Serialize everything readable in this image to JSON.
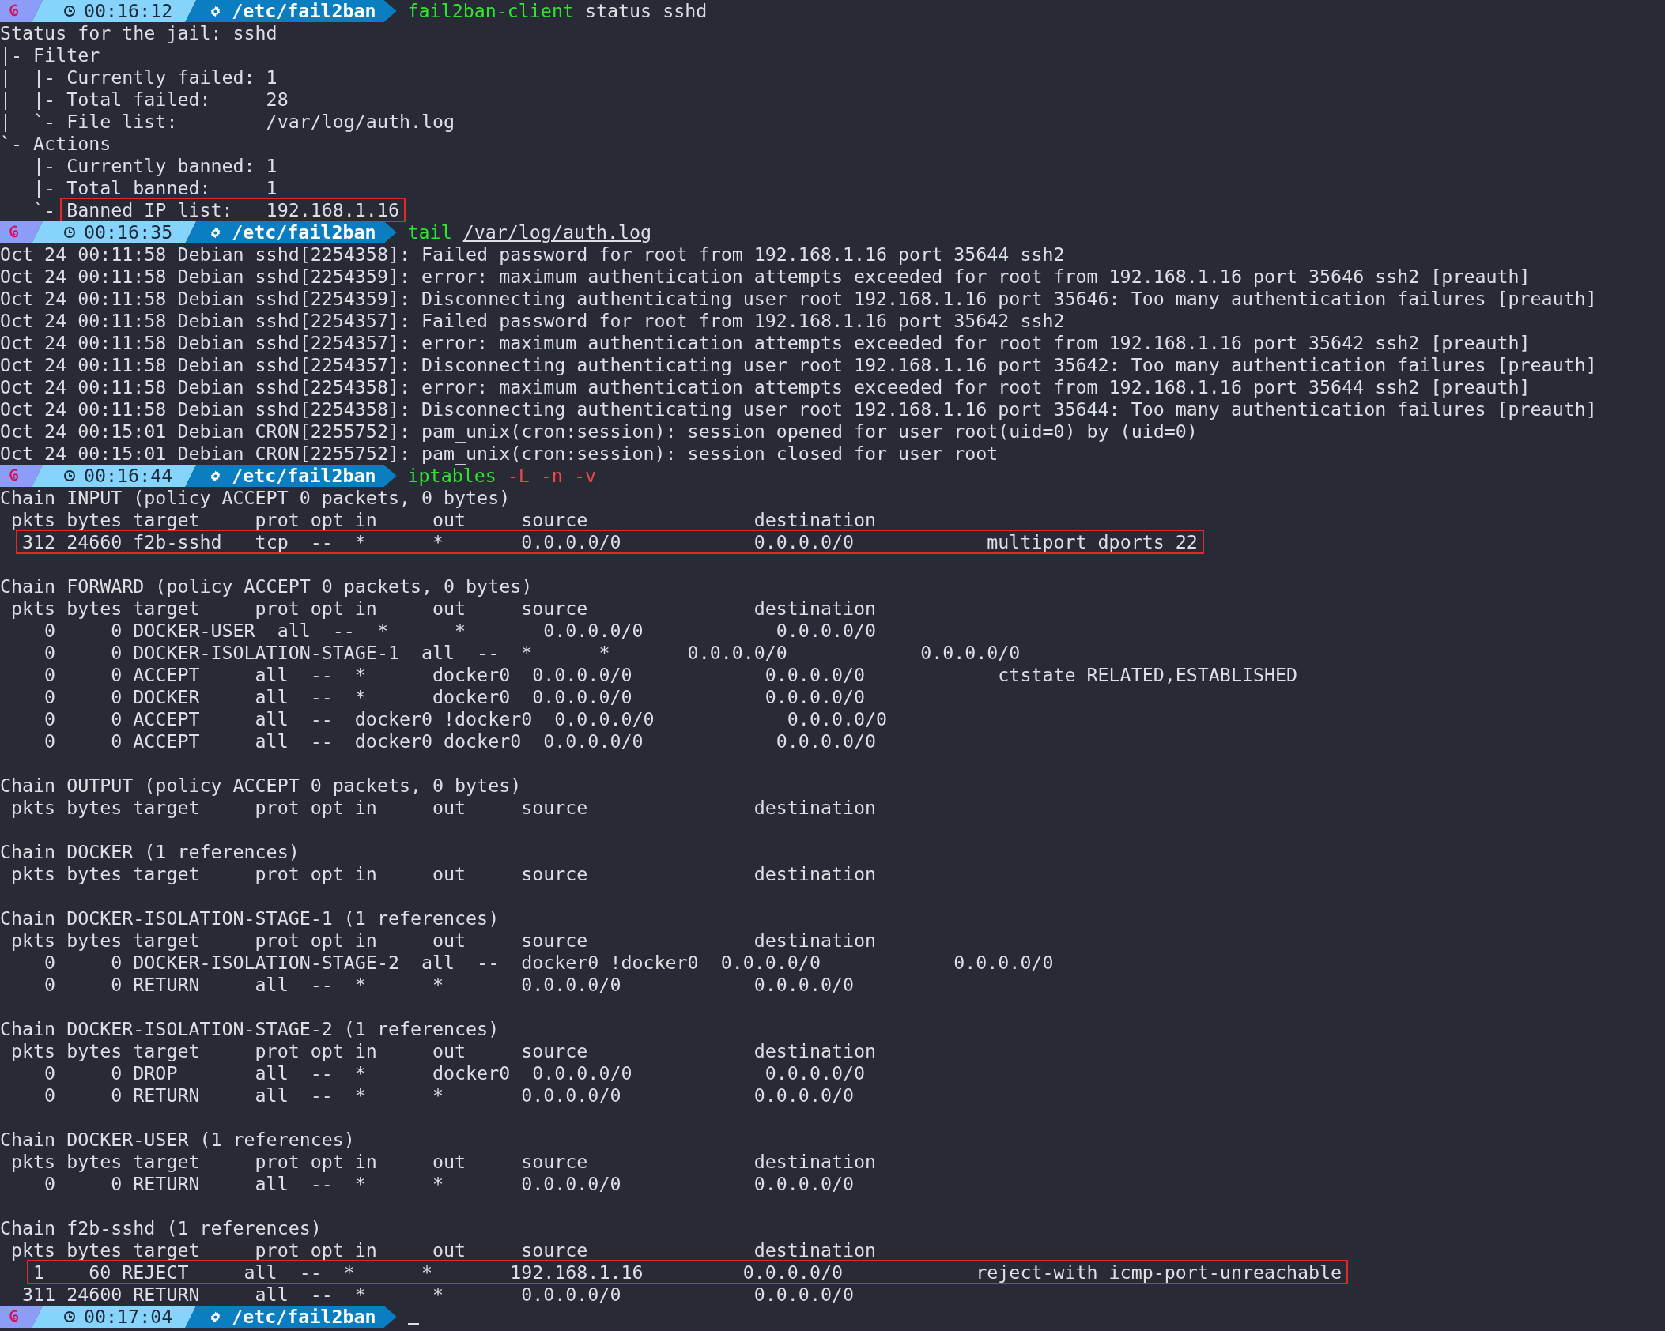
{
  "lines": [
    {
      "kind": "prompt",
      "time": "00:16:12",
      "path": "/etc/fail2ban",
      "command": "fail2ban-client",
      "args": [
        {
          "text": "status sshd",
          "kind": "plain"
        }
      ]
    },
    {
      "kind": "text",
      "text": "Status for the jail: sshd"
    },
    {
      "kind": "text",
      "text": "|- Filter"
    },
    {
      "kind": "text",
      "text": "|  |- Currently failed: 1"
    },
    {
      "kind": "text",
      "text": "|  |- Total failed:     28"
    },
    {
      "kind": "text",
      "text": "|  `- File list:        /var/log/auth.log"
    },
    {
      "kind": "text",
      "text": "`- Actions"
    },
    {
      "kind": "text",
      "text": "   |- Currently banned: 1"
    },
    {
      "kind": "text",
      "text": "   |- Total banned:     1"
    },
    {
      "kind": "boxed",
      "prefix": "   `- ",
      "text": "Banned IP list:   192.168.1.16"
    },
    {
      "kind": "prompt",
      "time": "00:16:35",
      "path": "/etc/fail2ban",
      "command": "tail",
      "args": [
        {
          "text": "/var/log/auth.log",
          "kind": "path"
        }
      ]
    },
    {
      "kind": "text",
      "text": "Oct 24 00:11:58 Debian sshd[2254358]: Failed password for root from 192.168.1.16 port 35644 ssh2"
    },
    {
      "kind": "text",
      "text": "Oct 24 00:11:58 Debian sshd[2254359]: error: maximum authentication attempts exceeded for root from 192.168.1.16 port 35646 ssh2 [preauth]"
    },
    {
      "kind": "text",
      "text": "Oct 24 00:11:58 Debian sshd[2254359]: Disconnecting authenticating user root 192.168.1.16 port 35646: Too many authentication failures [preauth]"
    },
    {
      "kind": "text",
      "text": "Oct 24 00:11:58 Debian sshd[2254357]: Failed password for root from 192.168.1.16 port 35642 ssh2"
    },
    {
      "kind": "text",
      "text": "Oct 24 00:11:58 Debian sshd[2254357]: error: maximum authentication attempts exceeded for root from 192.168.1.16 port 35642 ssh2 [preauth]"
    },
    {
      "kind": "text",
      "text": "Oct 24 00:11:58 Debian sshd[2254357]: Disconnecting authenticating user root 192.168.1.16 port 35642: Too many authentication failures [preauth]"
    },
    {
      "kind": "text",
      "text": "Oct 24 00:11:58 Debian sshd[2254358]: error: maximum authentication attempts exceeded for root from 192.168.1.16 port 35644 ssh2 [preauth]"
    },
    {
      "kind": "text",
      "text": "Oct 24 00:11:58 Debian sshd[2254358]: Disconnecting authenticating user root 192.168.1.16 port 35644: Too many authentication failures [preauth]"
    },
    {
      "kind": "text",
      "text": "Oct 24 00:15:01 Debian CRON[2255752]: pam_unix(cron:session): session opened for user root(uid=0) by (uid=0)"
    },
    {
      "kind": "text",
      "text": "Oct 24 00:15:01 Debian CRON[2255752]: pam_unix(cron:session): session closed for user root"
    },
    {
      "kind": "prompt",
      "time": "00:16:44",
      "path": "/etc/fail2ban",
      "command": "iptables",
      "args": [
        {
          "text": "-L",
          "kind": "flag"
        },
        {
          "text": "-n",
          "kind": "flag"
        },
        {
          "text": "-v",
          "kind": "flag"
        }
      ]
    },
    {
      "kind": "text",
      "text": "Chain INPUT (policy ACCEPT 0 packets, 0 bytes)"
    },
    {
      "kind": "text",
      "text": " pkts bytes target     prot opt in     out     source               destination"
    },
    {
      "kind": "boxed",
      "text": "  312 24660 f2b-sshd   tcp  --  *      *       0.0.0.0/0            0.0.0.0/0            multiport dports 22"
    },
    {
      "kind": "blank"
    },
    {
      "kind": "text",
      "text": "Chain FORWARD (policy ACCEPT 0 packets, 0 bytes)"
    },
    {
      "kind": "text",
      "text": " pkts bytes target     prot opt in     out     source               destination"
    },
    {
      "kind": "text",
      "text": "    0     0 DOCKER-USER  all  --  *      *       0.0.0.0/0            0.0.0.0/0"
    },
    {
      "kind": "text",
      "text": "    0     0 DOCKER-ISOLATION-STAGE-1  all  --  *      *       0.0.0.0/0            0.0.0.0/0"
    },
    {
      "kind": "text",
      "text": "    0     0 ACCEPT     all  --  *      docker0  0.0.0.0/0            0.0.0.0/0            ctstate RELATED,ESTABLISHED"
    },
    {
      "kind": "text",
      "text": "    0     0 DOCKER     all  --  *      docker0  0.0.0.0/0            0.0.0.0/0"
    },
    {
      "kind": "text",
      "text": "    0     0 ACCEPT     all  --  docker0 !docker0  0.0.0.0/0            0.0.0.0/0"
    },
    {
      "kind": "text",
      "text": "    0     0 ACCEPT     all  --  docker0 docker0  0.0.0.0/0            0.0.0.0/0"
    },
    {
      "kind": "blank"
    },
    {
      "kind": "text",
      "text": "Chain OUTPUT (policy ACCEPT 0 packets, 0 bytes)"
    },
    {
      "kind": "text",
      "text": " pkts bytes target     prot opt in     out     source               destination"
    },
    {
      "kind": "blank"
    },
    {
      "kind": "text",
      "text": "Chain DOCKER (1 references)"
    },
    {
      "kind": "text",
      "text": " pkts bytes target     prot opt in     out     source               destination"
    },
    {
      "kind": "blank"
    },
    {
      "kind": "text",
      "text": "Chain DOCKER-ISOLATION-STAGE-1 (1 references)"
    },
    {
      "kind": "text",
      "text": " pkts bytes target     prot opt in     out     source               destination"
    },
    {
      "kind": "text",
      "text": "    0     0 DOCKER-ISOLATION-STAGE-2  all  --  docker0 !docker0  0.0.0.0/0            0.0.0.0/0"
    },
    {
      "kind": "text",
      "text": "    0     0 RETURN     all  --  *      *       0.0.0.0/0            0.0.0.0/0"
    },
    {
      "kind": "blank"
    },
    {
      "kind": "text",
      "text": "Chain DOCKER-ISOLATION-STAGE-2 (1 references)"
    },
    {
      "kind": "text",
      "text": " pkts bytes target     prot opt in     out     source               destination"
    },
    {
      "kind": "text",
      "text": "    0     0 DROP       all  --  *      docker0  0.0.0.0/0            0.0.0.0/0"
    },
    {
      "kind": "text",
      "text": "    0     0 RETURN     all  --  *      *       0.0.0.0/0            0.0.0.0/0"
    },
    {
      "kind": "blank"
    },
    {
      "kind": "text",
      "text": "Chain DOCKER-USER (1 references)"
    },
    {
      "kind": "text",
      "text": " pkts bytes target     prot opt in     out     source               destination"
    },
    {
      "kind": "text",
      "text": "    0     0 RETURN     all  --  *      *       0.0.0.0/0            0.0.0.0/0"
    },
    {
      "kind": "blank"
    },
    {
      "kind": "text",
      "text": "Chain f2b-sshd (1 references)"
    },
    {
      "kind": "text",
      "text": " pkts bytes target     prot opt in     out     source               destination"
    },
    {
      "kind": "boxed",
      "text": "   1    60 REJECT     all  --  *      *       192.168.1.16         0.0.0.0/0            reject-with icmp-port-unreachable"
    },
    {
      "kind": "text",
      "text": "  311 24600 RETURN     all  --  *      *       0.0.0.0/0            0.0.0.0/0"
    },
    {
      "kind": "prompt",
      "time": "00:17:04",
      "path": "/etc/fail2ban",
      "cursor": true
    }
  ]
}
